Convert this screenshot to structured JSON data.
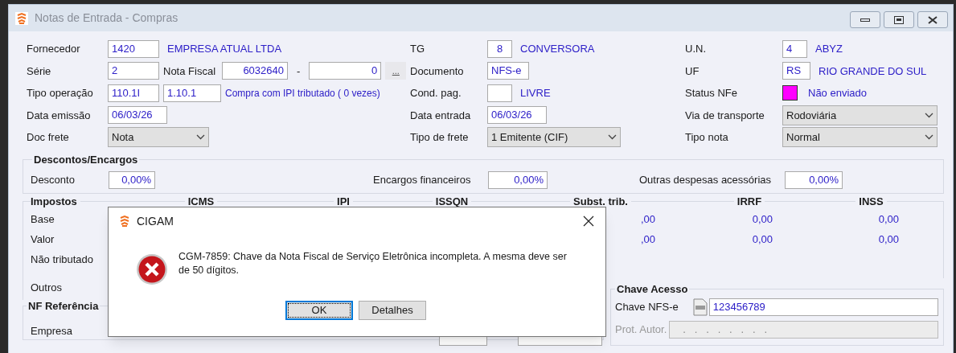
{
  "window": {
    "title": "Notas de Entrada - Compras"
  },
  "header": {
    "fornecedor": {
      "label": "Fornecedor",
      "code": "1420",
      "name": "EMPRESA ATUAL LTDA"
    },
    "serie": {
      "label": "Série",
      "value": "2"
    },
    "nota_fiscal": {
      "label": "Nota Fiscal",
      "number": "6032640",
      "separator": "-",
      "suffix": "0",
      "lookup": "..."
    },
    "tipo_operacao": {
      "label": "Tipo operação",
      "code": "110.1I",
      "subcode": "1.10.1",
      "description": "Compra com IPI tributado ( 0 vezes)"
    },
    "data_emissao": {
      "label": "Data emissão",
      "value": "06/03/26"
    },
    "doc_frete": {
      "label": "Doc frete",
      "value": "Nota"
    },
    "tg": {
      "label": "TG",
      "code": "8",
      "name": "CONVERSORA"
    },
    "documento": {
      "label": "Documento",
      "value": "NFS-e"
    },
    "cond_pag": {
      "label": "Cond. pag.",
      "name": "LIVRE"
    },
    "data_entrada": {
      "label": "Data entrada",
      "value": "06/03/26"
    },
    "tipo_frete": {
      "label": "Tipo de frete",
      "value": "1 Emitente (CIF)"
    },
    "un": {
      "label": "U.N.",
      "code": "4",
      "name": "ABYZ"
    },
    "uf": {
      "label": "UF",
      "code": "RS",
      "name": "RIO GRANDE DO SUL"
    },
    "status_nfe": {
      "label": "Status NFe",
      "color": "#ff00ff",
      "text": "Não enviado"
    },
    "via_transporte": {
      "label": "Via de transporte",
      "value": "Rodoviária"
    },
    "tipo_nota": {
      "label": "Tipo nota",
      "value": "Normal"
    }
  },
  "descontos": {
    "title": "Descontos/Encargos",
    "fields": [
      {
        "label": "Desconto",
        "value": "0,00%"
      },
      {
        "label": "Encargos financeiros",
        "value": "0,00%"
      },
      {
        "label": "Outras despesas acessórias",
        "value": "0,00%"
      }
    ]
  },
  "impostos": {
    "title": "Impostos",
    "columns": [
      "ICMS",
      "IPI",
      "ISSQN",
      "Subst. trib.",
      "IRRF",
      "INSS"
    ],
    "rows": [
      {
        "label": "Base",
        "values": [
          ",00",
          "0,00",
          "0,00"
        ]
      },
      {
        "label": "Valor",
        "values": [
          ",00",
          "0,00",
          "0,00"
        ]
      },
      {
        "label": "Não tributado",
        "values": []
      },
      {
        "label": "Outros",
        "values": []
      }
    ]
  },
  "nf_referencia": {
    "title": "NF Referência",
    "label": "Empresa"
  },
  "chave_acesso": {
    "title": "Chave Acesso",
    "chave_label": "Chave NFS-e",
    "chave_value": "123456789",
    "protocolo_label": "Prot. Autor.",
    "protocolo_value": ".   .   .   .   .   .   .   .",
    "protocolo_disabled": true
  },
  "dialog": {
    "title": "CIGAM",
    "message": "CGM-7859: Chave da Nota Fiscal de Serviço Eletrônica incompleta. A mesma deve ser de 50 dígitos.",
    "buttons": [
      {
        "label": "OK",
        "selected": true
      },
      {
        "label": "Detalhes",
        "selected": false
      }
    ]
  }
}
